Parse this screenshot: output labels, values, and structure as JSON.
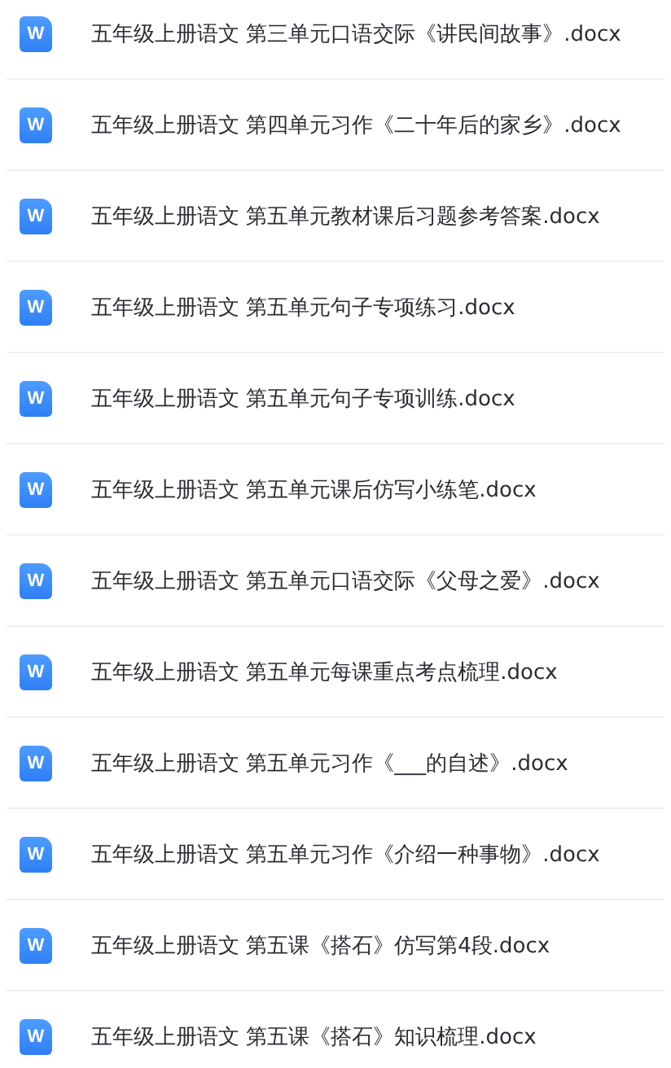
{
  "files": [
    {
      "icon": "W",
      "name": "五年级上册语文 第三单元口语交际《讲民间故事》.docx"
    },
    {
      "icon": "W",
      "name": "五年级上册语文 第四单元习作《二十年后的家乡》.docx"
    },
    {
      "icon": "W",
      "name": "五年级上册语文 第五单元教材课后习题参考答案.docx"
    },
    {
      "icon": "W",
      "name": "五年级上册语文 第五单元句子专项练习.docx"
    },
    {
      "icon": "W",
      "name": "五年级上册语文 第五单元句子专项训练.docx"
    },
    {
      "icon": "W",
      "name": "五年级上册语文 第五单元课后仿写小练笔.docx"
    },
    {
      "icon": "W",
      "name": "五年级上册语文 第五单元口语交际《父母之爱》.docx"
    },
    {
      "icon": "W",
      "name": "五年级上册语文 第五单元每课重点考点梳理.docx"
    },
    {
      "icon": "W",
      "name": "五年级上册语文 第五单元习作《___的自述》.docx"
    },
    {
      "icon": "W",
      "name": "五年级上册语文 第五单元习作《介绍一种事物》.docx"
    },
    {
      "icon": "W",
      "name": "五年级上册语文 第五课《搭石》仿写第4段.docx"
    },
    {
      "icon": "W",
      "name": "五年级上册语文 第五课《搭石》知识梳理.docx"
    }
  ]
}
